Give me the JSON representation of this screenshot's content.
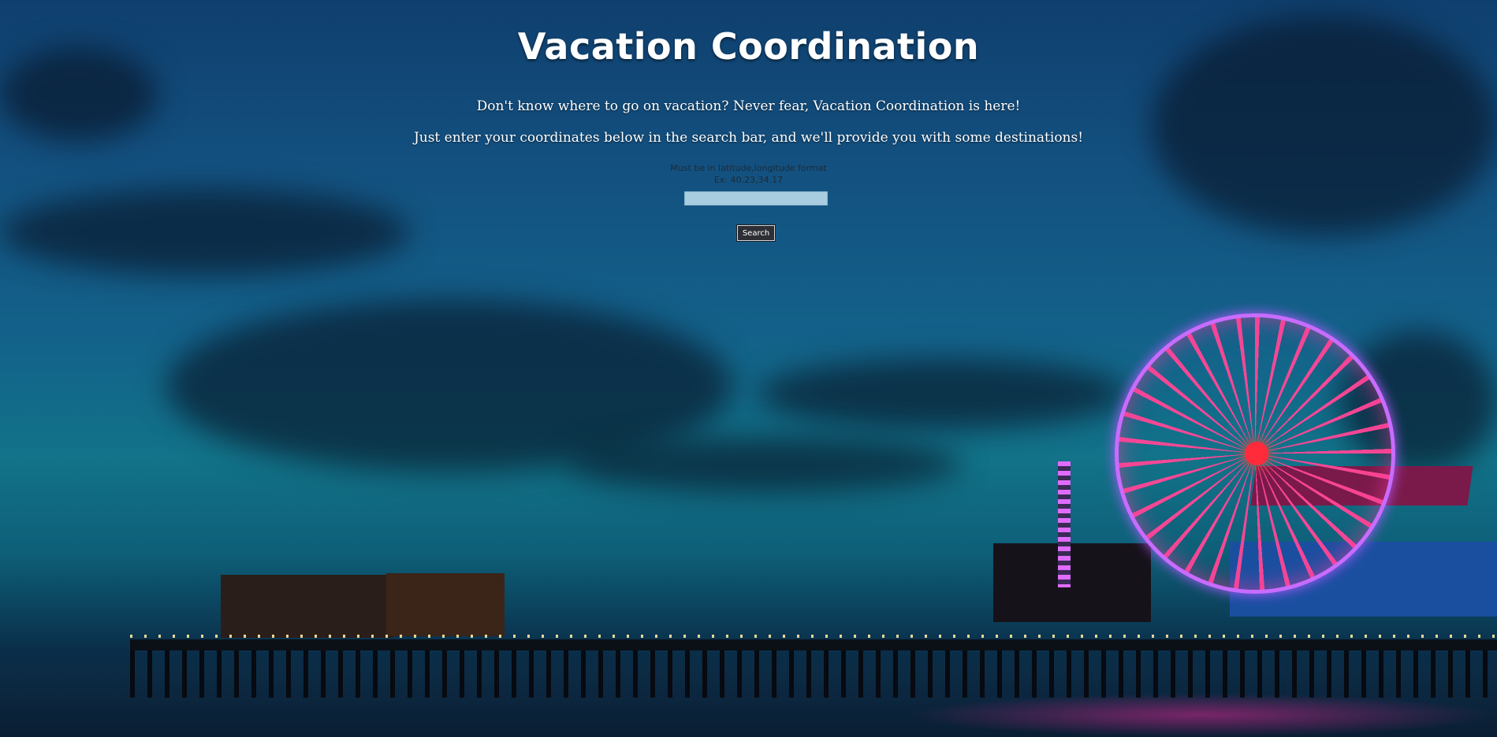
{
  "header": {
    "title": "Vacation Coordination"
  },
  "intro": {
    "line1": "Don't know where to go on vacation? Never fear, Vacation Coordination is here!",
    "line2": "Just enter your coordinates below in the search bar, and we'll provide you with some destinations!"
  },
  "search": {
    "format_hint": "Must be in latitude,longitude format",
    "example_hint": "Ex: 40.23,34.17",
    "input_value": "",
    "button_label": "Search"
  }
}
